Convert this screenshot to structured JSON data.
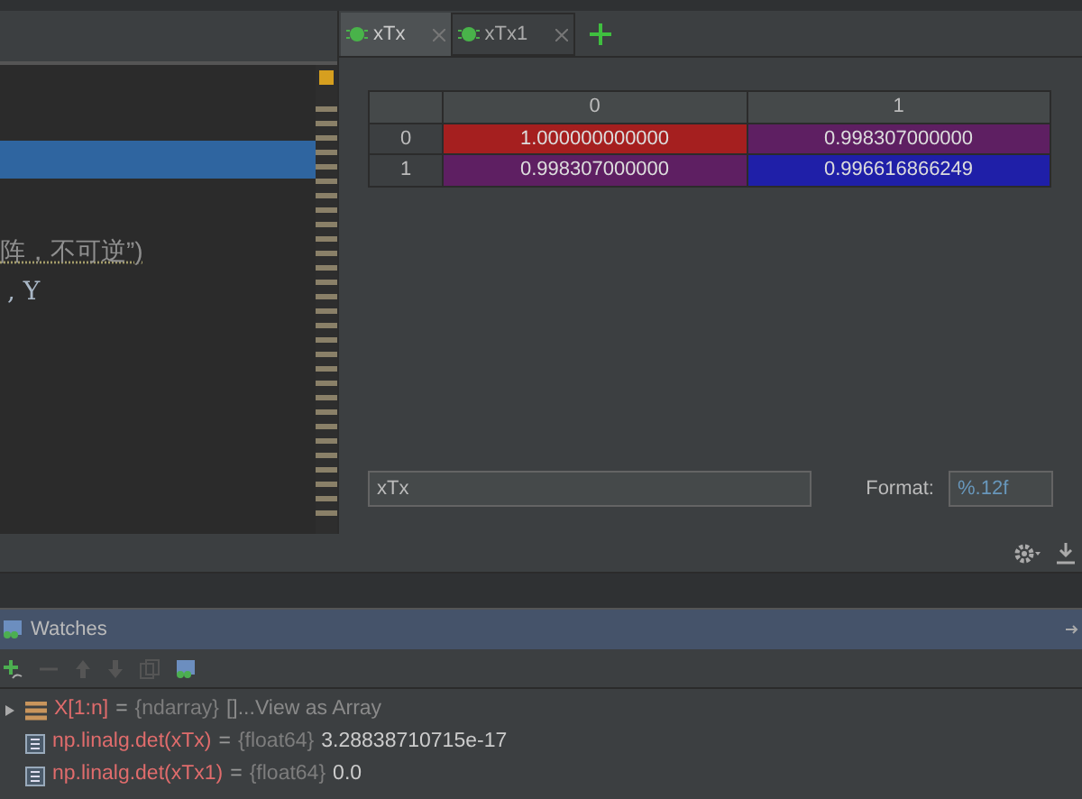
{
  "editor": {
    "lines": [
      {
        "kind": "highlight"
      },
      {
        "kind": "string",
        "text": "阵，不可逆”)"
      },
      {
        "kind": "code",
        "text": ", Y"
      }
    ]
  },
  "tabs": [
    {
      "label": "xTx",
      "selected": true
    },
    {
      "label": "xTx1",
      "selected": false
    }
  ],
  "table": {
    "columns": [
      "0",
      "1"
    ],
    "rows": [
      {
        "header": "0",
        "cells": [
          {
            "text": "1.000000000000",
            "color": "#a51f1f"
          },
          {
            "text": "0.998307000000",
            "color": "#5e1f62"
          }
        ]
      },
      {
        "header": "1",
        "cells": [
          {
            "text": "0.998307000000",
            "color": "#5e1f62"
          },
          {
            "text": "0.996616866249",
            "color": "#1f1fa8"
          }
        ]
      }
    ]
  },
  "name_field": {
    "value": "xTx"
  },
  "format": {
    "label": "Format:",
    "value": "%.12f"
  },
  "watches": {
    "title": "Watches",
    "items": [
      {
        "kind": "array",
        "expanded": false,
        "name": "X[1:n]",
        "separator": "=",
        "type": "{ndarray}",
        "value": "[]...View as Array"
      },
      {
        "kind": "scalar",
        "name": "np.linalg.det(xTx)",
        "separator": "=",
        "type": "{float64}",
        "value": "3.28838710715e-17"
      },
      {
        "kind": "scalar",
        "name": "np.linalg.det(xTx1)",
        "separator": "=",
        "type": "{float64}",
        "value": "0.0"
      }
    ]
  }
}
